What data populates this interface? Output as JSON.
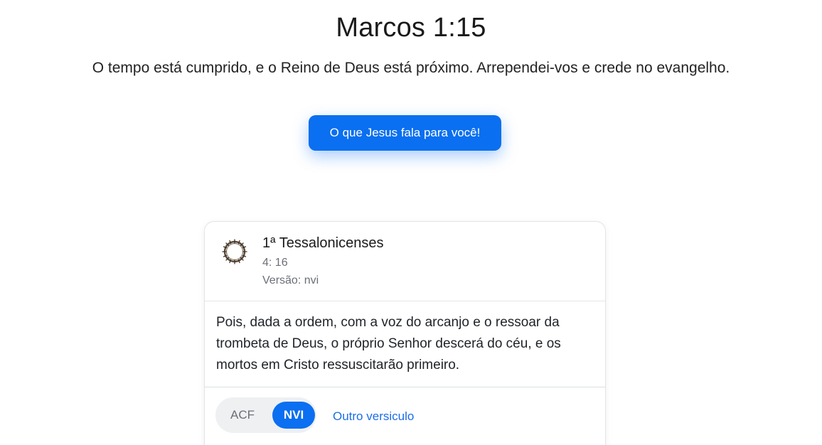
{
  "header": {
    "title": "Marcos 1:15",
    "verse_text": "O tempo está cumprido, e o Reino de Deus está próximo. Arrependei-vos e crede no evangelho."
  },
  "cta": {
    "label": "O que Jesus fala para você!"
  },
  "card": {
    "icon": "crown-of-thorns-icon",
    "book": "1ª Tessalonicenses",
    "reference": "4: 16",
    "version_label": "Versão: nvi",
    "text": "Pois, dada a ordem, com a voz do arcanjo e o ressoar da trombeta de Deus, o próprio Senhor descerá do céu, e os mortos em Cristo ressuscitarão primeiro.",
    "versions": [
      {
        "label": "ACF",
        "active": false
      },
      {
        "label": "NVI",
        "active": true
      }
    ],
    "other_link": "Outro versiculo"
  },
  "colors": {
    "accent": "#0a6ff0",
    "link": "#1a6ee8"
  }
}
